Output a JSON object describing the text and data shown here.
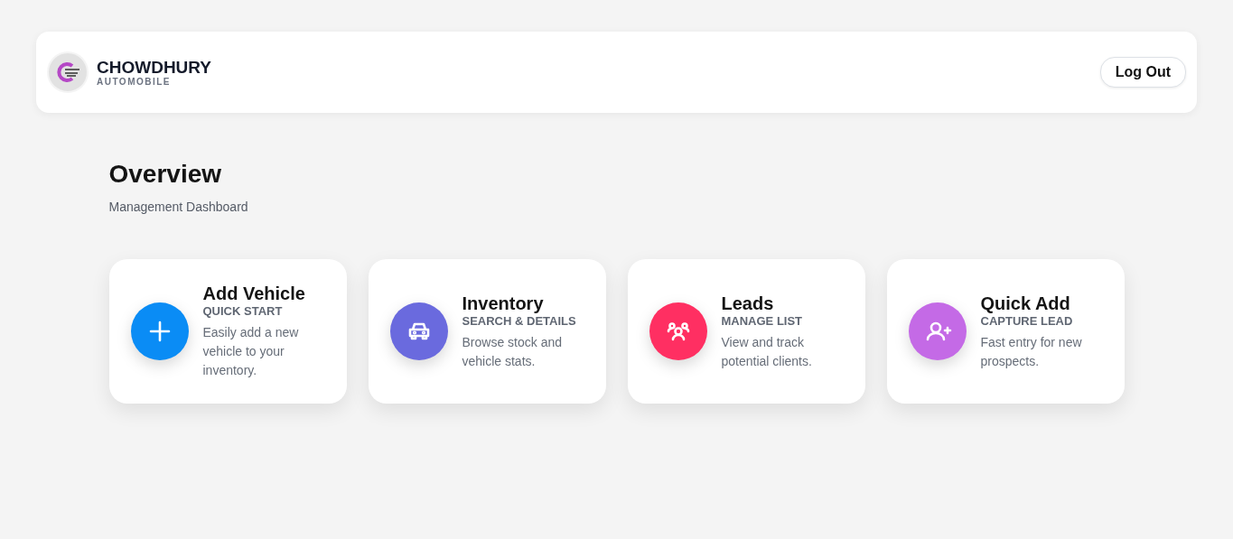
{
  "header": {
    "brand": "CHOWDHURY",
    "tagline": "AUTOMOBILE",
    "logout": "Log Out"
  },
  "page": {
    "title": "Overview",
    "subtitle": "Management Dashboard"
  },
  "cards": [
    {
      "kind": "plus",
      "color": "#0a8cf5",
      "title": "Add Vehicle",
      "subtitle": "QUICK START",
      "description": "Easily add a new vehicle to your inventory."
    },
    {
      "kind": "car",
      "color": "#6a6ade",
      "title": "Inventory",
      "subtitle": "SEARCH & DETAILS",
      "description": "Browse stock and vehicle stats."
    },
    {
      "kind": "people",
      "color": "#ff2f62",
      "title": "Leads",
      "subtitle": "MANAGE LIST",
      "description": "View and track potential clients."
    },
    {
      "kind": "user-plus",
      "color": "#c46ae6",
      "title": "Quick Add",
      "subtitle": "CAPTURE LEAD",
      "description": "Fast entry for new prospects."
    }
  ]
}
